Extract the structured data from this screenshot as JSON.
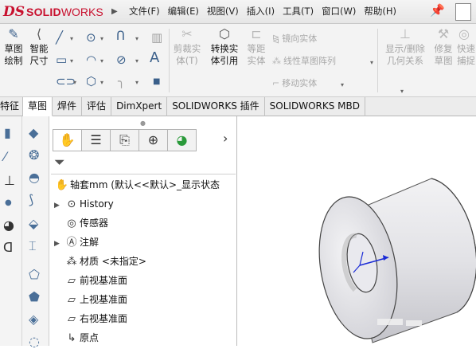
{
  "app": {
    "logo_ds": "DS",
    "logo_brand": "SOLID",
    "logo_brand2": "WORKS",
    "menu": [
      "文件(F)",
      "编辑(E)",
      "视图(V)",
      "插入(I)",
      "工具(T)",
      "窗口(W)",
      "帮助(H)"
    ]
  },
  "ribbon": {
    "sketch_draw": "草图\n绘制",
    "smart_dim": "智能\n尺寸",
    "trim": "剪裁实\n体(T)",
    "convert": "转换实\n体引用",
    "offset": "等距\n实体",
    "mirror": "镜向实体",
    "linear_pattern": "线性草图阵列",
    "move": "移动实体",
    "relations": "显示/删除\n几何关系",
    "repair": "修复\n草图",
    "quick_snap": "快速\n捕捉"
  },
  "tabs": [
    "特征",
    "草图",
    "焊件",
    "评估",
    "DimXpert",
    "SOLIDWORKS 插件",
    "SOLIDWORKS MBD"
  ],
  "tree": {
    "root": "轴套mm  (默认<<默认>_显示状态",
    "items": [
      {
        "label": "History",
        "expandable": true
      },
      {
        "label": "传感器",
        "expandable": false
      },
      {
        "label": "注解",
        "expandable": true
      },
      {
        "label": "材质 <未指定>",
        "expandable": false
      },
      {
        "label": "前视基准面",
        "expandable": false
      },
      {
        "label": "上视基准面",
        "expandable": false
      },
      {
        "label": "右视基准面",
        "expandable": false
      },
      {
        "label": "原点",
        "expandable": false
      }
    ]
  },
  "colors": {
    "brand": "#c8102e",
    "axis": "#1a2bd6"
  }
}
